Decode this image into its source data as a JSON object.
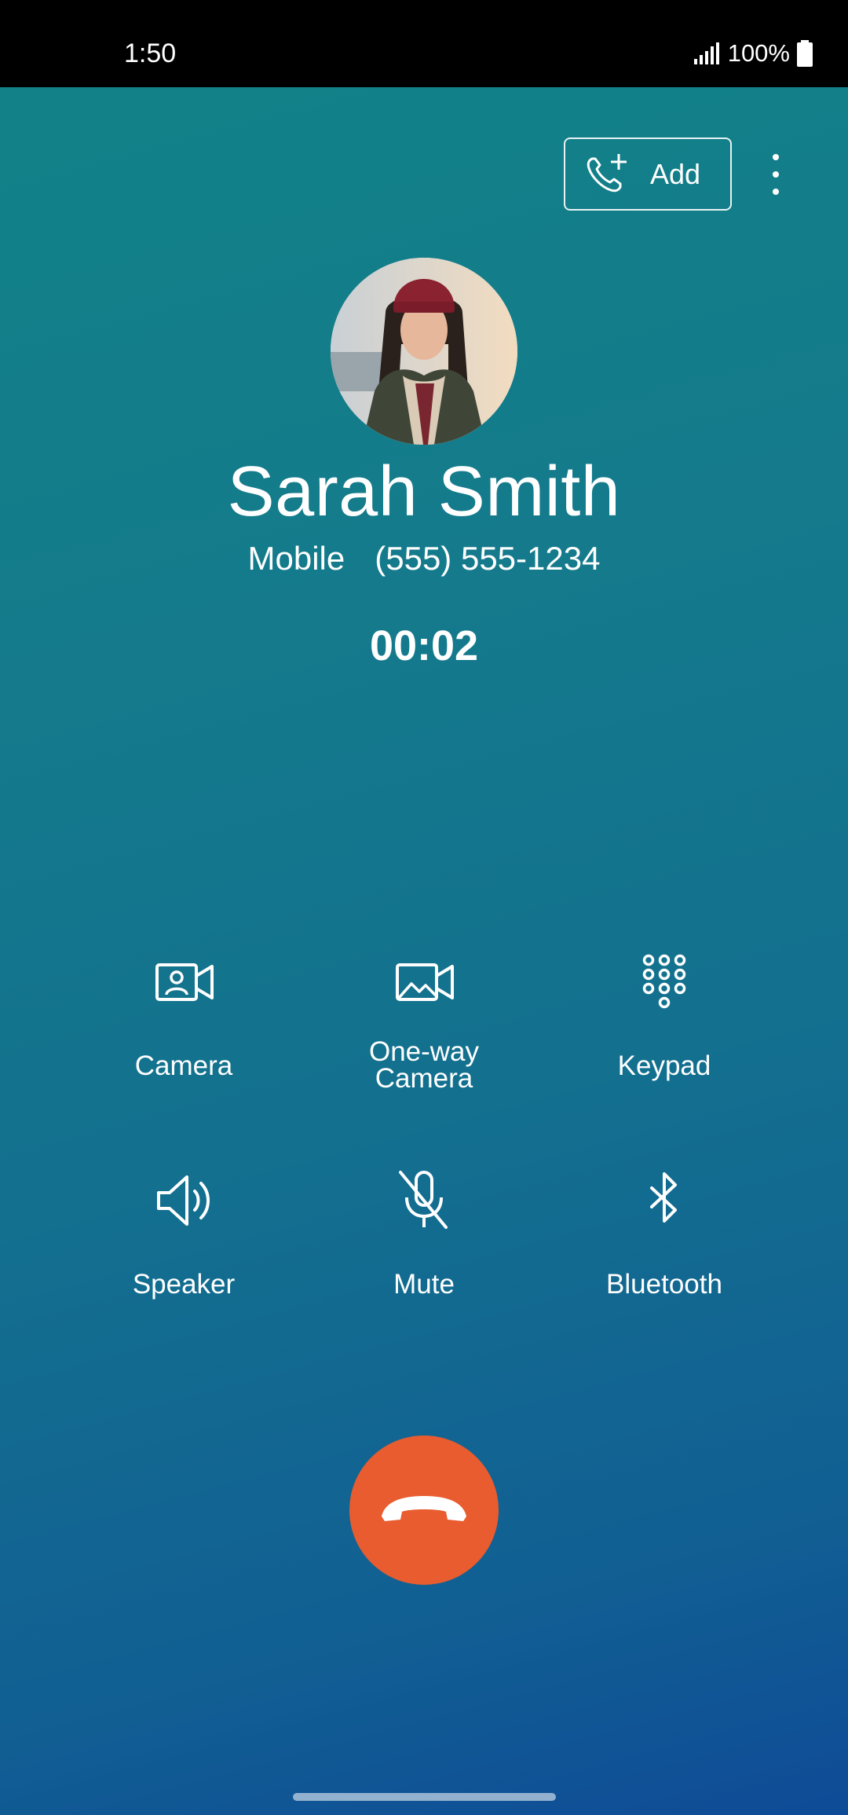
{
  "status_bar": {
    "time": "1:50",
    "battery": "100%"
  },
  "header": {
    "add_label": "Add"
  },
  "contact": {
    "name": "Sarah Smith",
    "phone_type": "Mobile",
    "phone_number": "(555) 555-1234"
  },
  "call": {
    "timer": "00:02"
  },
  "controls": {
    "camera": {
      "label": "Camera",
      "icon": "video-camera-person-icon"
    },
    "one_way_camera": {
      "label_line1": "One-way",
      "label_line2": "Camera",
      "icon": "one-way-camera-icon"
    },
    "keypad": {
      "label": "Keypad",
      "icon": "keypad-icon"
    },
    "speaker": {
      "label": "Speaker",
      "icon": "speaker-icon"
    },
    "mute": {
      "label": "Mute",
      "icon": "mic-off-icon"
    },
    "bluetooth": {
      "label": "Bluetooth",
      "icon": "bluetooth-icon"
    }
  },
  "colors": {
    "end_call": "#e85c2f",
    "bg_top": "#118387",
    "bg_bottom": "#0f4b97"
  }
}
